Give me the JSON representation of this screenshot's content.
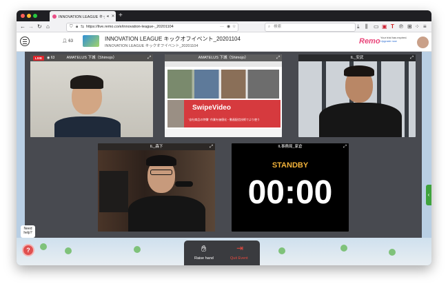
{
  "browser": {
    "tab_title": "INNOVATION LEAGUE キックオ",
    "url": "https://live.remo.co/e/innovation-league-_20201104",
    "search_placeholder": "検索"
  },
  "event": {
    "attendee_count": "63",
    "title": "INNOVATION LEAGUE キックオフイベント_20201104",
    "subtitle": "INNOVATION LEAGUE キックオフイベント_20201104",
    "logo_text": "Remo",
    "trial_text": "Your trial has expired.",
    "upgrade_text": "Upgrade now"
  },
  "tiles": [
    {
      "label": "AMATELUS 下城（Shimojo）",
      "live": "LIVE",
      "viewers": "63"
    },
    {
      "label": "AMATELUS 下城（Shimojo）",
      "slide_brand": "SwipeVideo",
      "slide_caption": "\"自社商品の特徴\" 作業を価値化・動画配信技術でより使う"
    },
    {
      "label": "IL_安武"
    },
    {
      "label": "IL_森下"
    },
    {
      "label": "IL事務局_家倉",
      "standby": "STANDBY",
      "timer": "00:00"
    }
  ],
  "actions": {
    "raise_hand": "Raise hand",
    "quit_event": "Quit Event"
  },
  "help": {
    "need_help": "Need help?"
  },
  "colors": {
    "live_red": "#e0262c",
    "standby_orange": "#f2b23a",
    "quit_red": "#e8493f",
    "remo_pink": "#e9457a"
  }
}
